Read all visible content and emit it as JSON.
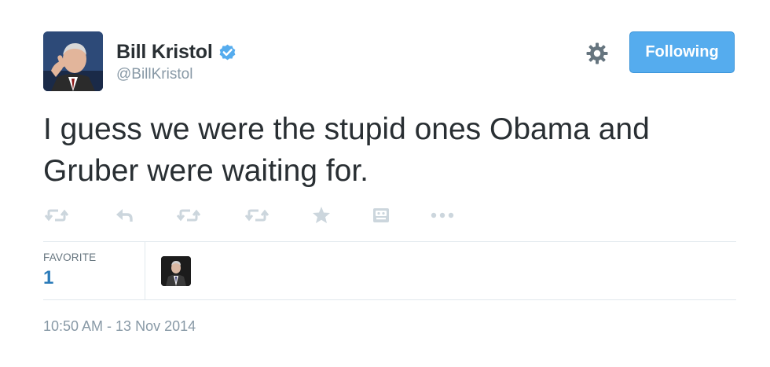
{
  "author": {
    "full_name": "Bill Kristol",
    "handle": "@BillKristol",
    "verified": true
  },
  "header": {
    "follow_label": "Following",
    "settings_icon": "gear-icon"
  },
  "tweet": {
    "text": "I guess we were the stupid ones Obama and Gruber were waiting for."
  },
  "actions": [
    {
      "name": "retweet-icon"
    },
    {
      "name": "reply-icon"
    },
    {
      "name": "retweet-icon"
    },
    {
      "name": "retweet-icon"
    },
    {
      "name": "favorite-star-icon"
    },
    {
      "name": "photo-icon"
    },
    {
      "name": "more-options-icon"
    }
  ],
  "stats": {
    "favorite_label": "FAVORITE",
    "favorite_count": "1"
  },
  "timestamp": "10:50 AM - 13 Nov 2014",
  "colors": {
    "accent": "#55acee",
    "text": "#292f33",
    "muted": "#8899a6",
    "link": "#2b7bb9",
    "icon": "#ccd6dd"
  }
}
